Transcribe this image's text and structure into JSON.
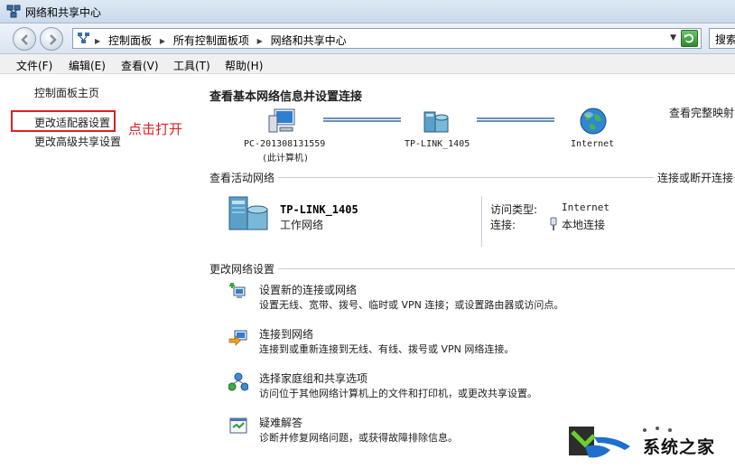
{
  "window": {
    "title": "网络和共享中心"
  },
  "address": {
    "crumbs": [
      "控制面板",
      "所有控制面板项",
      "网络和共享中心"
    ],
    "search_text": "搜索"
  },
  "menu": [
    "文件(F)",
    "编辑(E)",
    "查看(V)",
    "工具(T)",
    "帮助(H)"
  ],
  "sidebar": {
    "items": [
      {
        "label": "控制面板主页"
      },
      {
        "label": "更改适配器设置"
      },
      {
        "label": "更改高级共享设置"
      }
    ],
    "annotation": "点击打开"
  },
  "main": {
    "heading": "查看基本网络信息并设置连接",
    "full_map": "查看完整映射",
    "nodes": [
      {
        "label": "PC-201308131559",
        "sublabel": "(此计算机)"
      },
      {
        "label": "TP-LINK_1405"
      },
      {
        "label": "Internet"
      }
    ],
    "active_title": "查看活动网络",
    "connect_toggle": "连接或断开连接",
    "network": {
      "name": "TP-LINK_1405",
      "type": "工作网络"
    },
    "access_type_label": "访问类型:",
    "access_type_value": "Internet",
    "connection_label": "连接:",
    "connection_value": "本地连接",
    "change_title": "更改网络设置",
    "tasks": [
      {
        "title": "设置新的连接或网络",
        "desc": "设置无线、宽带、拨号、临时或 VPN 连接；或设置路由器或访问点。"
      },
      {
        "title": "连接到网络",
        "desc": "连接到或重新连接到无线、有线、拨号或 VPN 网络连接。"
      },
      {
        "title": "选择家庭组和共享选项",
        "desc": "访问位于其他网络计算机上的文件和打印机，或更改共享设置。"
      },
      {
        "title": "疑难解答",
        "desc": "诊断并修复网络问题，或获得故障排除信息。"
      }
    ]
  },
  "watermark": {
    "text": "系统之家"
  }
}
